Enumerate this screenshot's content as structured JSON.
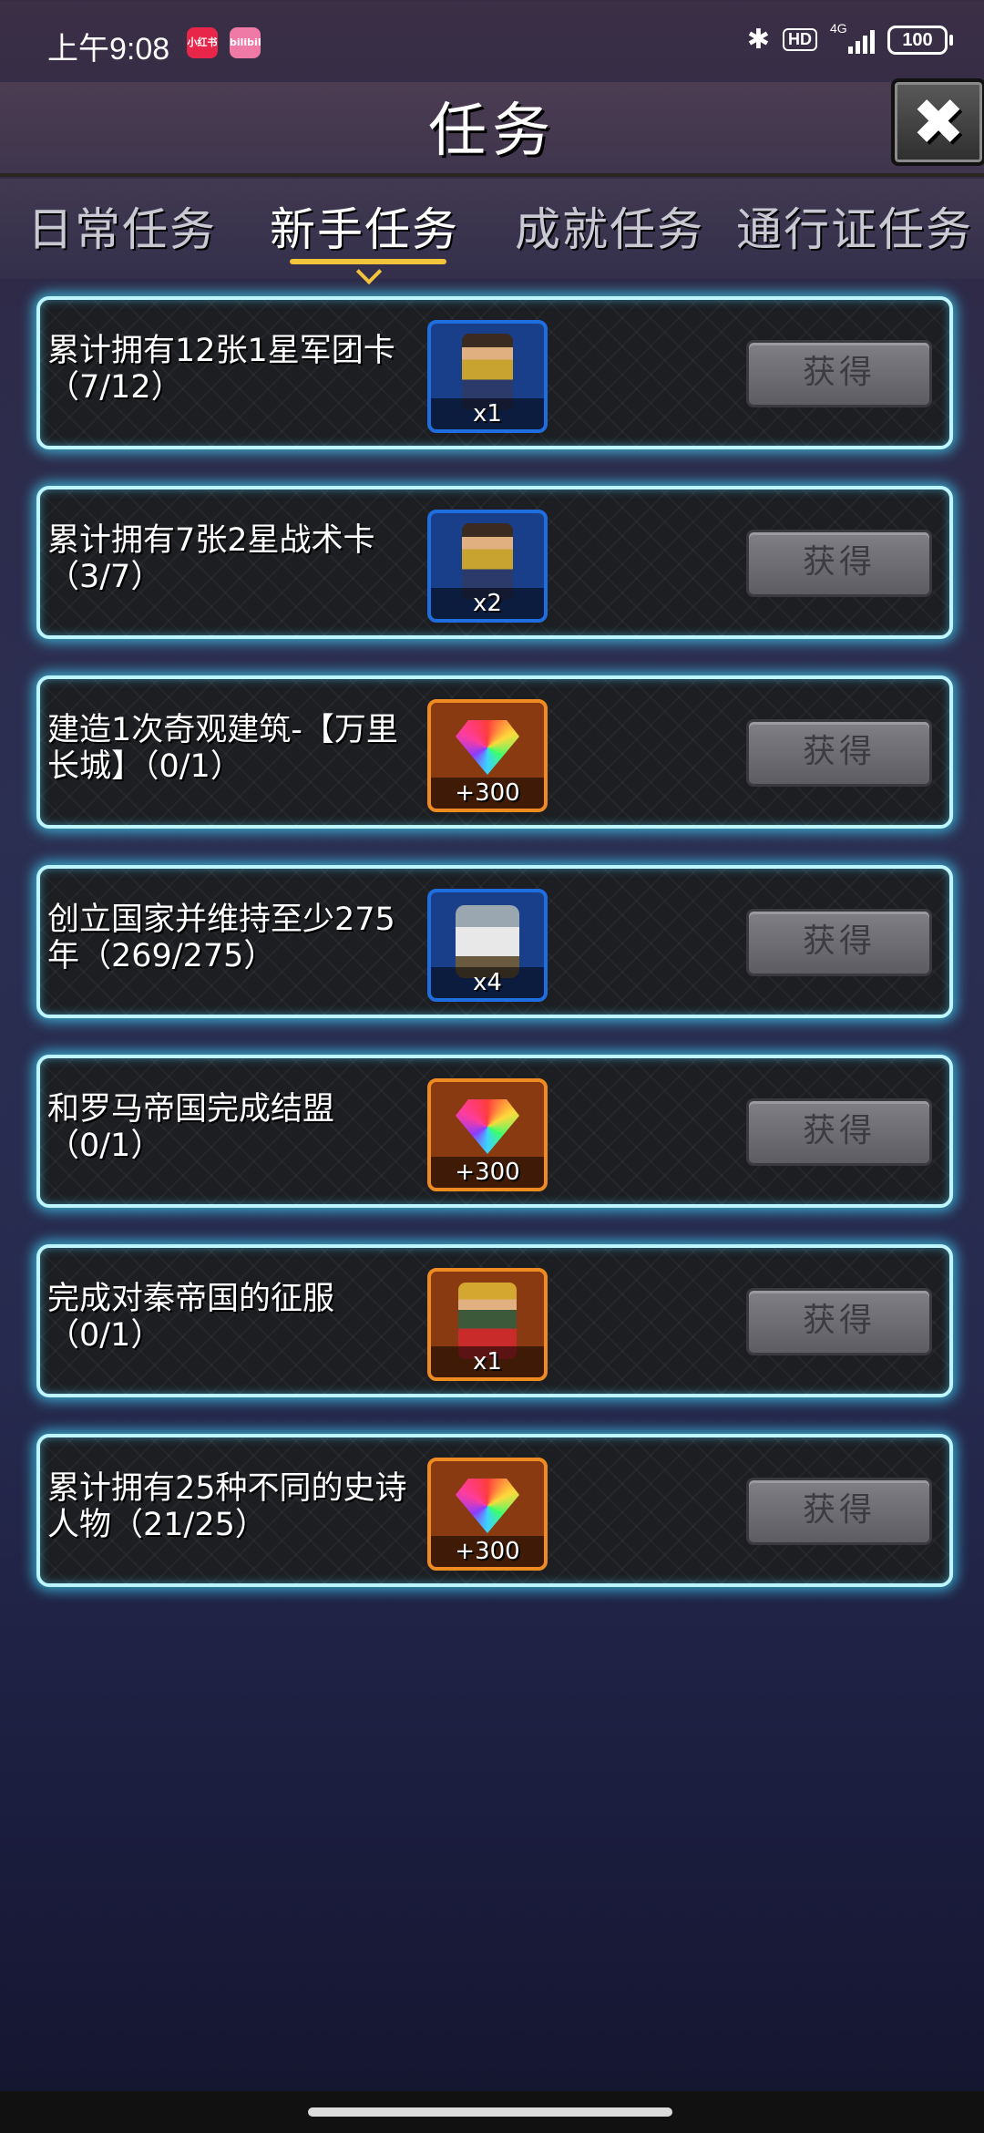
{
  "status_bar": {
    "time": "上午9:08",
    "apps": [
      {
        "name": "小红书",
        "color": "#e8264a"
      },
      {
        "name": "bilibili",
        "color": "#f07aa6"
      }
    ],
    "icons": [
      "bluetooth-icon",
      "hd-icon",
      "signal-4g-icon",
      "battery-icon"
    ],
    "hd_label": "HD",
    "network_label": "4G",
    "battery": "100"
  },
  "header": {
    "title": "任务",
    "close_icon": "close-icon"
  },
  "tabs": [
    {
      "label": "日常任务",
      "active": false
    },
    {
      "label": "新手任务",
      "active": true
    },
    {
      "label": "成就任务",
      "active": false
    },
    {
      "label": "通行证任务",
      "active": false
    }
  ],
  "tasks": [
    {
      "text": "累计拥有12张1星军团卡（7/12）",
      "reward_icon": "hero-card-icon",
      "reward_amount": "x1",
      "reward_frame": "blue",
      "button": "获得"
    },
    {
      "text": "累计拥有7张2星战术卡（3/7）",
      "reward_icon": "hero-card-icon",
      "reward_amount": "x2",
      "reward_frame": "blue",
      "button": "获得"
    },
    {
      "text": "建造1次奇观建筑-【万里长城】（0/1）",
      "reward_icon": "gem-icon",
      "reward_amount": "+300",
      "reward_frame": "orange",
      "button": "获得"
    },
    {
      "text": "创立国家并维持至少275年（269/275）",
      "reward_icon": "knight-card-icon",
      "reward_amount": "x4",
      "reward_frame": "blue",
      "button": "获得"
    },
    {
      "text": "和罗马帝国完成结盟（0/1）",
      "reward_icon": "gem-icon",
      "reward_amount": "+300",
      "reward_frame": "orange",
      "button": "获得"
    },
    {
      "text": "完成对秦帝国的征服（0/1）",
      "reward_icon": "general-card-icon",
      "reward_amount": "x1",
      "reward_frame": "orange",
      "button": "获得"
    },
    {
      "text": "累计拥有25种不同的史诗人物（21/25）",
      "reward_icon": "gem-icon",
      "reward_amount": "+300",
      "reward_frame": "orange",
      "button": "获得"
    }
  ],
  "colors": {
    "card_border": "#bff5ff",
    "card_glow": "#40dcff",
    "tab_indicator": "#f3c53a",
    "reward_blue": "#1f6ee0",
    "reward_orange": "#f08a22",
    "button_disabled": "#6e6e74"
  }
}
